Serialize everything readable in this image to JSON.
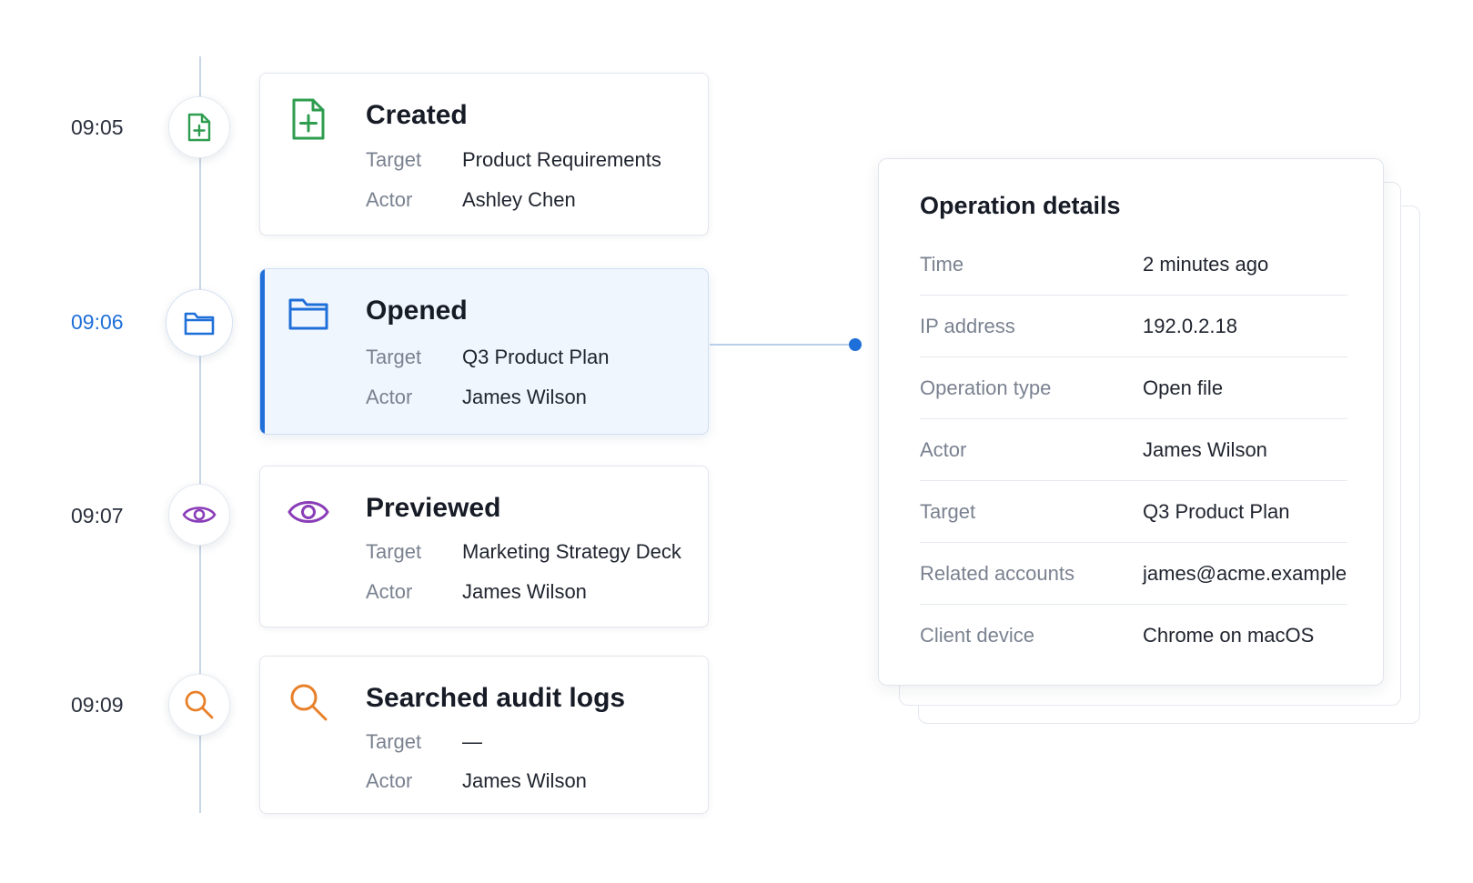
{
  "timeline": [
    {
      "time": "09:05",
      "title": "Created",
      "target_label": "Target",
      "target": "Product Requirements",
      "actor_label": "Actor",
      "actor": "Ashley Chen",
      "icon": "file-plus-icon",
      "color": "#2e9d4f"
    },
    {
      "time": "09:06",
      "title": "Opened",
      "target_label": "Target",
      "target": "Q3 Product Plan",
      "actor_label": "Actor",
      "actor": "James Wilson",
      "icon": "folder-icon",
      "color": "#1f6fd9",
      "selected": true
    },
    {
      "time": "09:07",
      "title": "Previewed",
      "target_label": "Target",
      "target": "Marketing Strategy Deck",
      "actor_label": "Actor",
      "actor": "James Wilson",
      "icon": "eye-icon",
      "color": "#8a3db8"
    },
    {
      "time": "09:09",
      "title": "Searched audit logs",
      "target_label": "Target",
      "target": "—",
      "actor_label": "Actor",
      "actor": "James Wilson",
      "icon": "search-icon",
      "color": "#e8802a"
    }
  ],
  "details": {
    "title": "Operation details",
    "rows": [
      {
        "label": "Time",
        "value": "2 minutes ago"
      },
      {
        "label": "IP address",
        "value": "192.0.2.18"
      },
      {
        "label": "Operation type",
        "value": "Open file"
      },
      {
        "label": "Actor",
        "value": "James Wilson"
      },
      {
        "label": "Target",
        "value": "Q3 Product Plan"
      },
      {
        "label": "Related accounts",
        "value": "james@acme.example"
      },
      {
        "label": "Client device",
        "value": "Chrome on macOS"
      }
    ]
  },
  "accent_color": "#1f6fd9"
}
